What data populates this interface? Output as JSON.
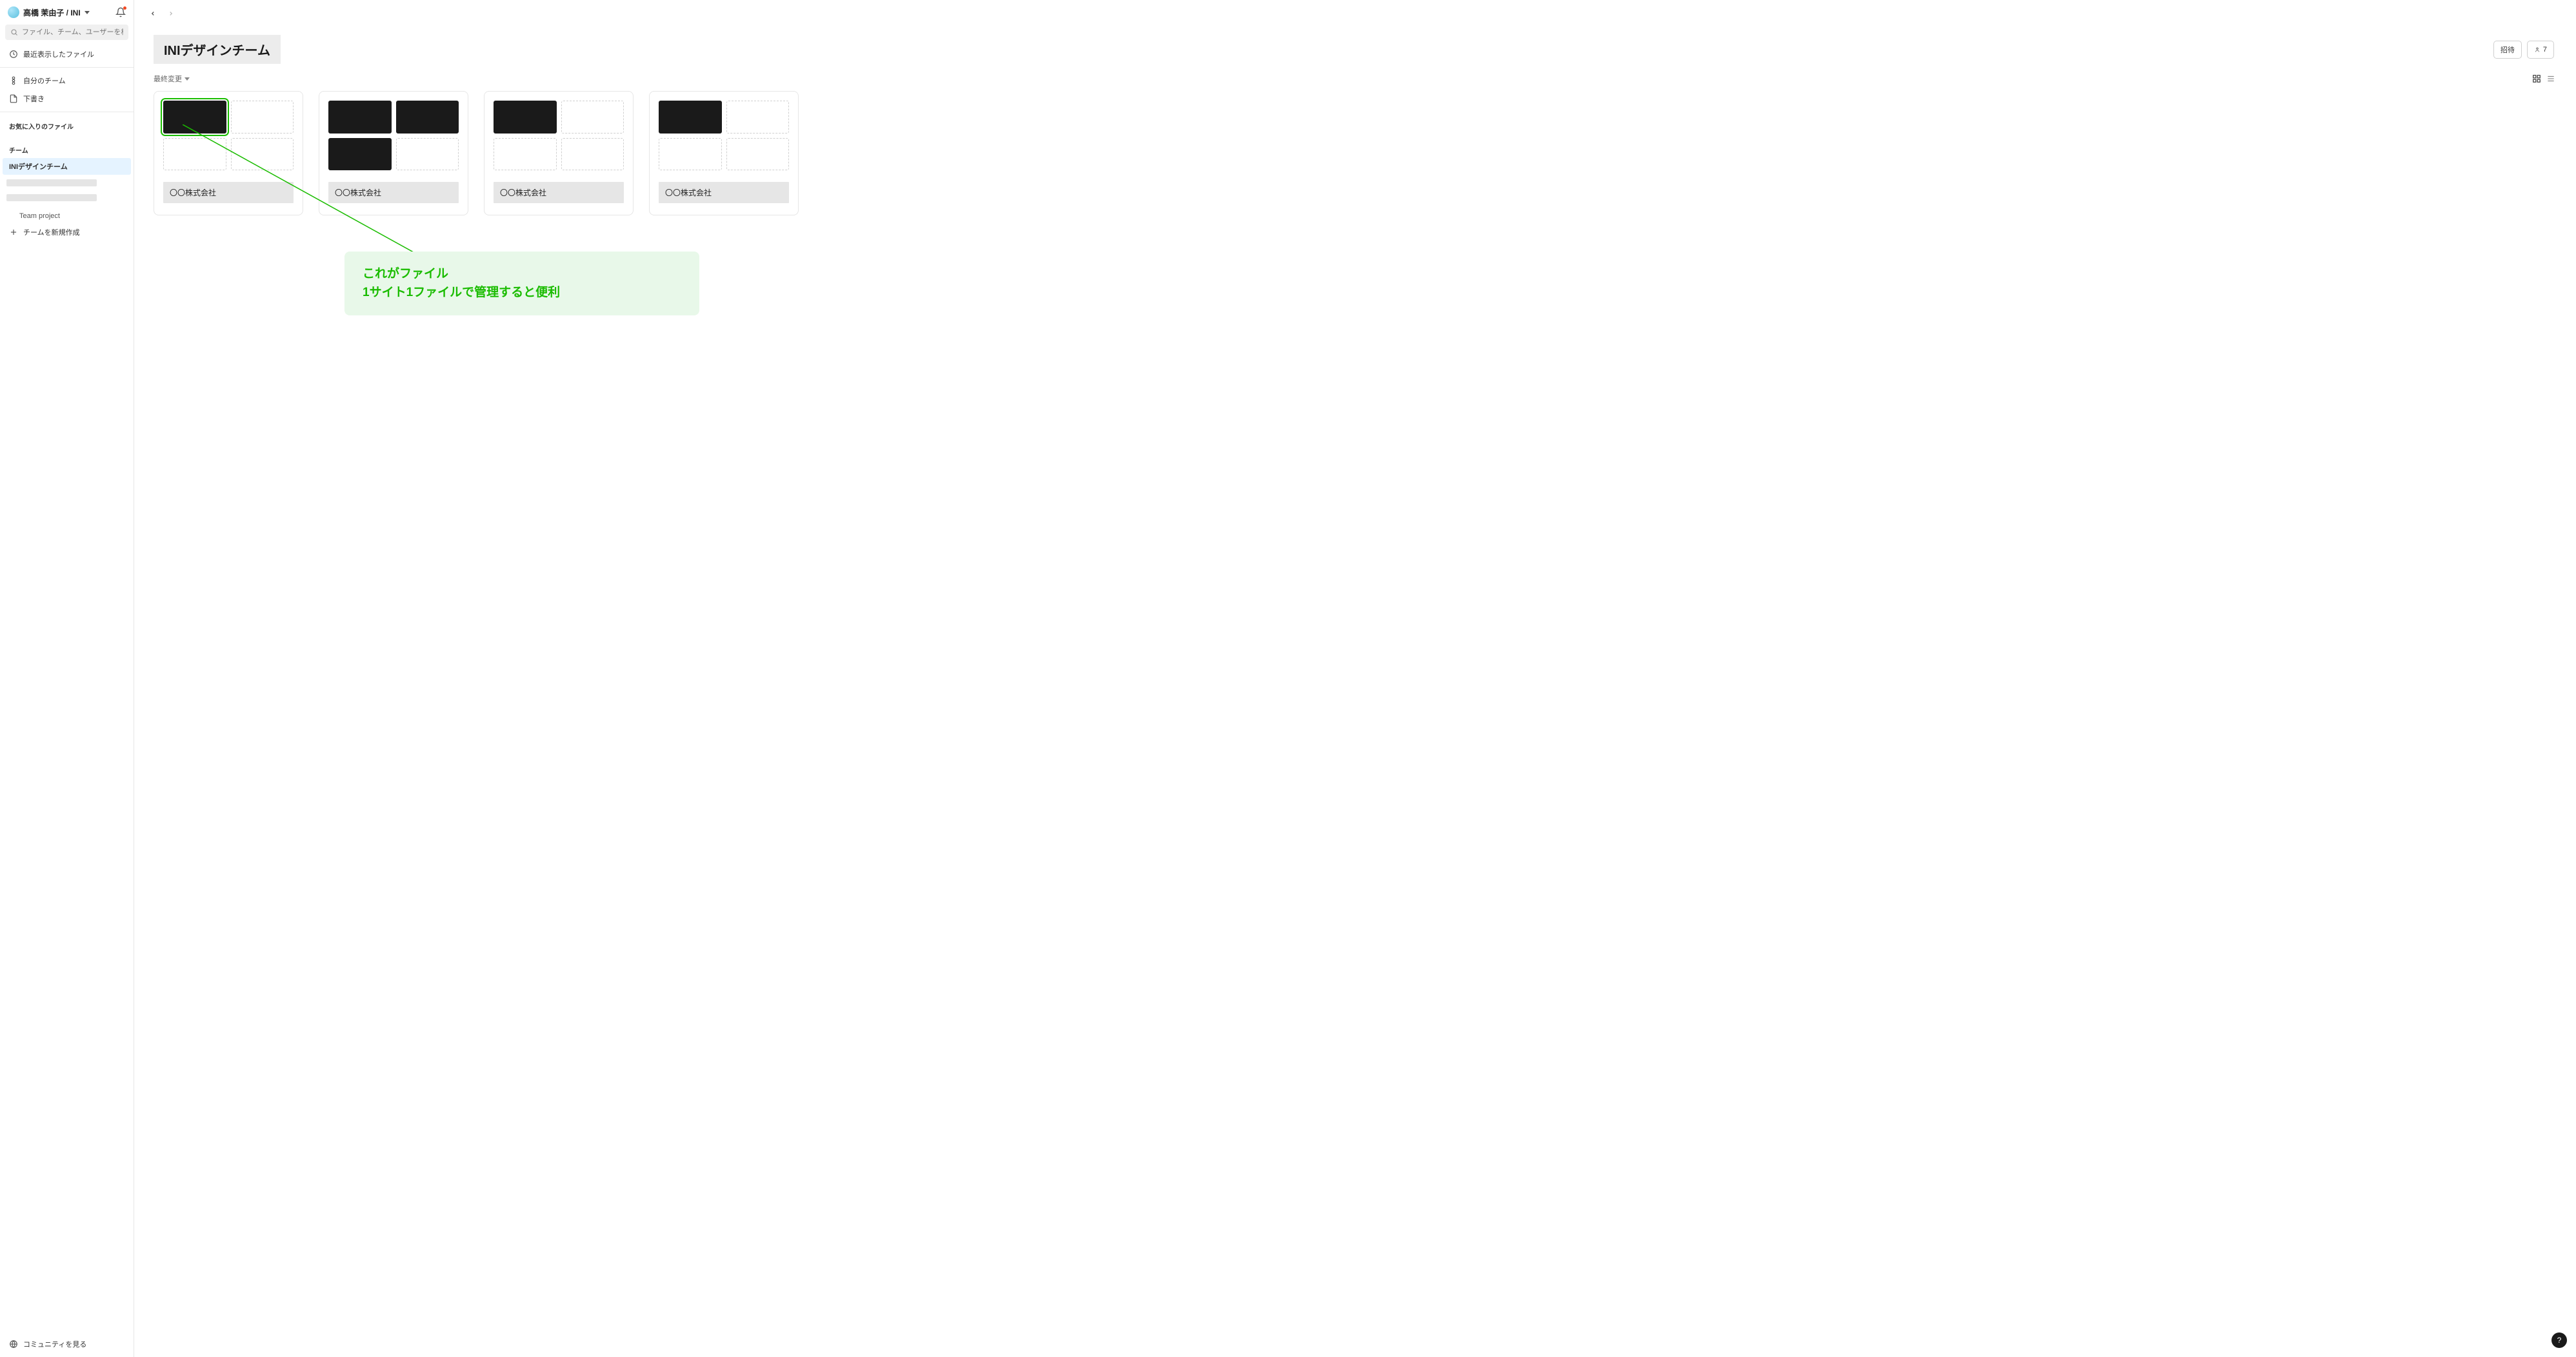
{
  "sidebar": {
    "user_name": "高橋 茉由子 / INI",
    "search_placeholder": "ファイル、チーム、ユーザーを検索",
    "recent_label": "最近表示したファイル",
    "my_teams_label": "自分のチーム",
    "drafts_label": "下書き",
    "favorites_section": "お気に入りのファイル",
    "team_section": "チーム",
    "teams": [
      {
        "name": "INIデザインチーム",
        "active": true
      },
      {
        "name": "",
        "active": false,
        "skeleton": true
      },
      {
        "name": "",
        "active": false,
        "skeleton": true
      }
    ],
    "projects": [
      {
        "name": "Team project"
      }
    ],
    "new_team_label": "チームを新規作成",
    "community_label": "コミュニティを見る"
  },
  "main": {
    "page_title": "INIデザインチーム",
    "invite_label": "招待",
    "member_count": "7",
    "sort_label": "最終変更",
    "cards": [
      {
        "title": "〇〇株式会社",
        "thumbs": [
          "filled-highlight",
          "empty",
          "empty",
          "empty"
        ]
      },
      {
        "title": "〇〇株式会社",
        "thumbs": [
          "filled",
          "filled",
          "filled",
          "empty"
        ]
      },
      {
        "title": "〇〇株式会社",
        "thumbs": [
          "filled",
          "empty",
          "empty",
          "empty"
        ]
      },
      {
        "title": "〇〇株式会社",
        "thumbs": [
          "filled",
          "empty",
          "empty",
          "empty"
        ]
      }
    ]
  },
  "annotation": {
    "line1": "これがファイル",
    "line2": "1サイト1ファイルで管理すると便利"
  },
  "help": {
    "label": "?"
  },
  "colors": {
    "accent_green": "#1abc00",
    "anno_bg": "#e8f8e9",
    "selected_blue": "#e5f3ff",
    "thumb_dark": "#1a1a1a"
  }
}
